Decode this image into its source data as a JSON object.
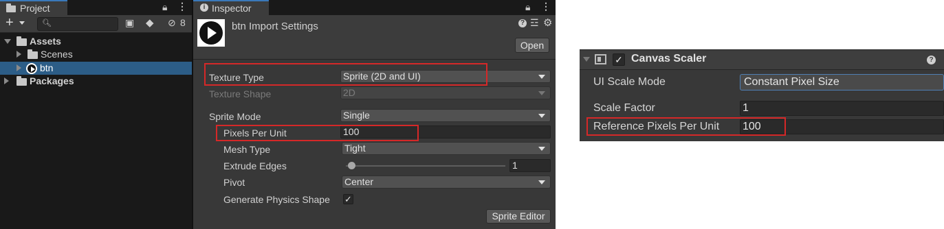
{
  "project": {
    "tab_label": "Project",
    "hidden_count": "8",
    "tree": [
      {
        "label": "Assets",
        "icon": "folder-open-icon"
      },
      {
        "label": "Scenes",
        "icon": "folder-icon"
      },
      {
        "label": "btn",
        "icon": "sprite-play-icon",
        "selected": true
      },
      {
        "label": "Packages",
        "icon": "folder-icon"
      }
    ]
  },
  "inspector": {
    "tab_label": "Inspector",
    "title": "btn Import Settings",
    "open_label": "Open",
    "texture_type_label": "Texture Type",
    "texture_type_value": "Sprite (2D and UI)",
    "texture_shape_label": "Texture Shape",
    "texture_shape_value": "2D",
    "sprite_mode_label": "Sprite Mode",
    "sprite_mode_value": "Single",
    "ppu_label": "Pixels Per Unit",
    "ppu_value": "100",
    "mesh_type_label": "Mesh Type",
    "mesh_type_value": "Tight",
    "extrude_label": "Extrude Edges",
    "extrude_value": "1",
    "pivot_label": "Pivot",
    "pivot_value": "Center",
    "physics_label": "Generate Physics Shape",
    "physics_checked": true,
    "sprite_editor_label": "Sprite Editor"
  },
  "canvas_scaler": {
    "title": "Canvas Scaler",
    "ui_scale_mode_label": "UI Scale Mode",
    "ui_scale_mode_value": "Constant Pixel Size",
    "scale_factor_label": "Scale Factor",
    "scale_factor_value": "1",
    "ref_ppu_label": "Reference Pixels Per Unit",
    "ref_ppu_value": "100"
  },
  "colors": {
    "highlight_box": "#d62828",
    "selection": "#2c5d87",
    "accent_blue": "#3a79bb",
    "panel_bg": "#383838"
  }
}
